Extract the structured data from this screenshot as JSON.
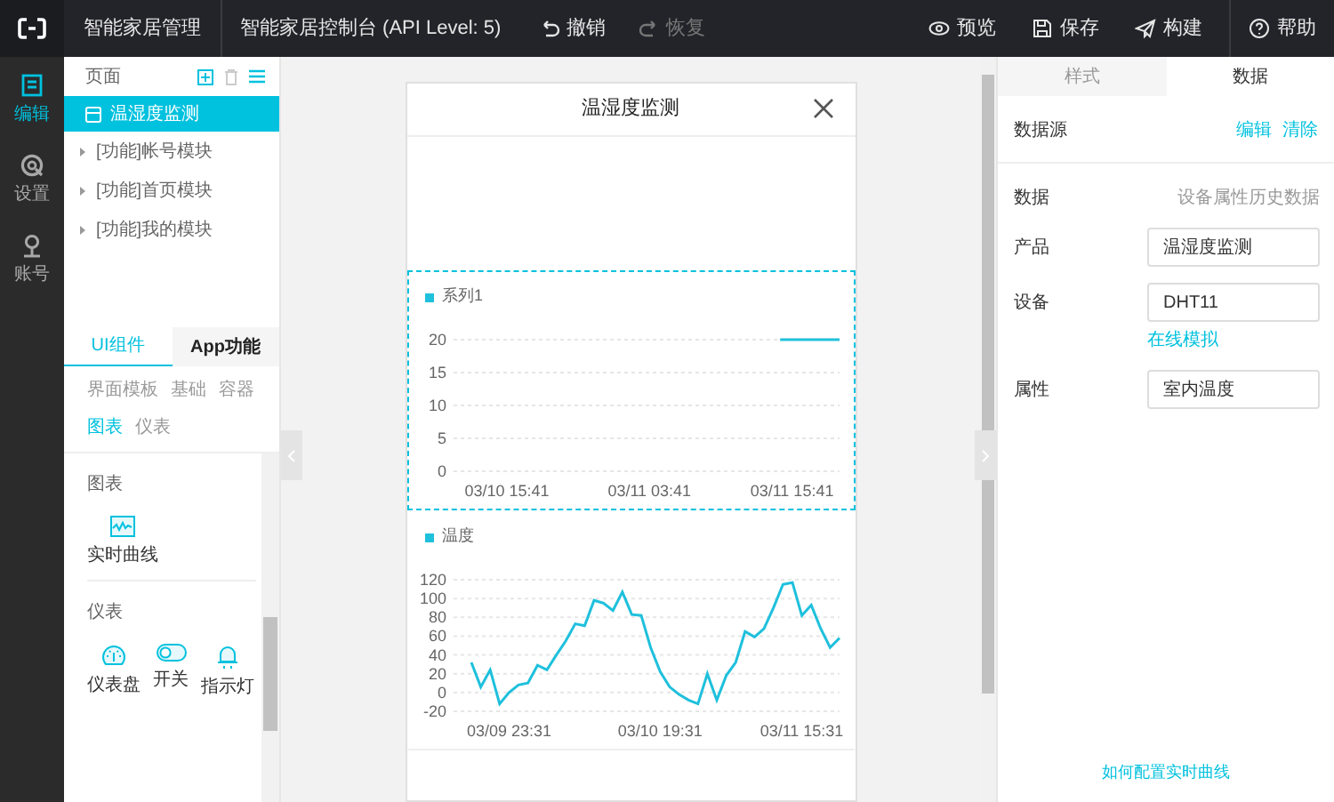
{
  "top_bar": {
    "app_name": "智能家居管理",
    "title": "智能家居控制台 (API Level: 5)",
    "edit_actions": [
      {
        "label": "撤销",
        "kind": "undo",
        "disabled": false
      },
      {
        "label": "恢复",
        "kind": "redo",
        "disabled": true
      }
    ],
    "actions": [
      {
        "label": "预览",
        "kind": "preview"
      },
      {
        "label": "保存",
        "kind": "save"
      },
      {
        "label": "构建",
        "kind": "build"
      },
      {
        "label": "帮助",
        "kind": "help"
      }
    ]
  },
  "nav_rail": [
    {
      "label": "编辑",
      "kind": "edit",
      "selected": true
    },
    {
      "label": "设置",
      "kind": "settings",
      "selected": false
    },
    {
      "label": "账号",
      "kind": "account",
      "selected": false
    }
  ],
  "pages_panel": {
    "title": "页面",
    "pages": [
      {
        "label": "温湿度监测",
        "selected": true
      },
      {
        "label": "[功能]帐号模块",
        "selected": false,
        "expanded": false
      },
      {
        "label": "[功能]首页模块",
        "selected": false,
        "expanded": false
      },
      {
        "label": "[功能]我的模块",
        "selected": false,
        "expanded": false
      }
    ]
  },
  "components_panel": {
    "tabs": [
      {
        "label": "UI组件",
        "selected": true
      },
      {
        "label": "App功能",
        "selected": false
      }
    ],
    "category_rows": [
      [
        {
          "label": "界面模板",
          "selected": false
        },
        {
          "label": "基础",
          "selected": false
        },
        {
          "label": "容器",
          "selected": false
        }
      ],
      [
        {
          "label": "图表",
          "selected": true
        },
        {
          "label": "仪表",
          "selected": false
        }
      ]
    ],
    "sections": [
      {
        "title": "图表",
        "items": [
          {
            "label": "实时曲线",
            "kind": "realtime-curve"
          }
        ]
      },
      {
        "title": "仪表",
        "items": [
          {
            "label": "仪表盘",
            "kind": "gauge"
          },
          {
            "label": "开关",
            "kind": "switch"
          },
          {
            "label": "指示灯",
            "kind": "indicator"
          }
        ]
      }
    ]
  },
  "phone": {
    "title": "温湿度监测",
    "widgets": [
      {
        "selected": true,
        "chart_data": {
          "type": "line",
          "grid": true,
          "categories": [
            "03/10 15:41",
            null,
            null,
            null,
            null,
            null,
            null,
            null,
            null,
            null,
            null,
            null,
            "03/11 03:41",
            null,
            null,
            null,
            null,
            null,
            null,
            null,
            null,
            null,
            null,
            null,
            "03/11 15:41",
            null,
            null,
            null,
            null
          ],
          "ylim": [
            0,
            20
          ],
          "yticks": [
            0,
            5,
            10,
            15,
            20
          ],
          "series": [
            {
              "name": "系列1",
              "color": "#1ec0dc",
              "values": [
                null,
                null,
                null,
                null,
                null,
                null,
                null,
                null,
                null,
                null,
                null,
                null,
                null,
                null,
                null,
                null,
                null,
                null,
                null,
                null,
                null,
                null,
                null,
                20,
                20,
                20,
                20,
                20,
                20
              ]
            }
          ]
        }
      },
      {
        "selected": false,
        "chart_data": {
          "type": "line",
          "grid": true,
          "categories": [
            null,
            null,
            null,
            null,
            "03/09 23:31",
            null,
            null,
            null,
            null,
            null,
            null,
            null,
            null,
            null,
            null,
            null,
            null,
            null,
            null,
            null,
            "03/10 19:31",
            null,
            null,
            null,
            null,
            null,
            null,
            null,
            null,
            null,
            null,
            null,
            null,
            null,
            null,
            "03/11 15:31",
            null,
            null,
            null,
            null
          ],
          "ylim": [
            -20,
            120
          ],
          "yticks": [
            -20,
            0,
            20,
            40,
            60,
            80,
            100,
            120
          ],
          "series": [
            {
              "name": "温度",
              "color": "#1ec0dc",
              "values": [
                32,
                6,
                24,
                -12,
                0,
                8,
                10,
                29,
                24,
                40,
                55,
                73,
                71,
                98,
                95,
                87,
                107,
                83,
                82,
                48,
                22,
                6,
                -2,
                -8,
                -12,
                20,
                -8,
                18,
                32,
                65,
                59,
                68,
                90,
                115,
                117,
                82,
                93,
                68,
                48,
                58
              ]
            }
          ]
        }
      }
    ]
  },
  "props_panel": {
    "tabs": [
      {
        "label": "样式",
        "selected": false
      },
      {
        "label": "数据",
        "selected": true
      }
    ],
    "data_source": {
      "label": "数据源",
      "links": [
        "编辑",
        "清除"
      ]
    },
    "fields": [
      {
        "label": "数据",
        "kind": "text",
        "value": "设备属性历史数据"
      },
      {
        "label": "产品",
        "kind": "input",
        "value": "温湿度监测"
      },
      {
        "label": "设备",
        "kind": "input",
        "value": "DHT11",
        "link": "在线模拟"
      },
      {
        "label": "属性",
        "kind": "input",
        "value": "室内温度"
      }
    ],
    "help_link": "如何配置实时曲线"
  }
}
